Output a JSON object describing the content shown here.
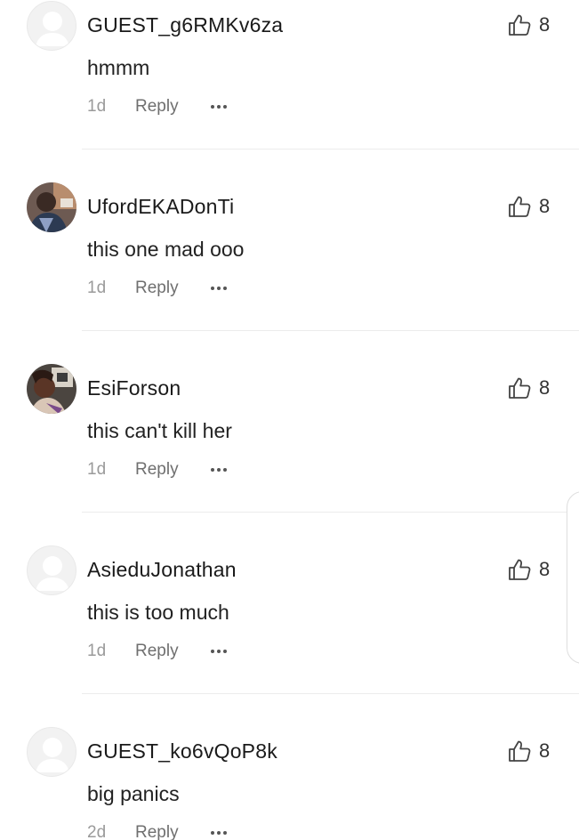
{
  "comments": [
    {
      "username": "GUEST_g6RMKv6za",
      "text": "hmmm",
      "time": "1d",
      "reply_label": "Reply",
      "likes": "8",
      "avatar": "default-avatar"
    },
    {
      "username": "UfordEKADonTi",
      "text": "this one mad ooo",
      "time": "1d",
      "reply_label": "Reply",
      "likes": "8",
      "avatar": "user-photo-avatar"
    },
    {
      "username": "EsiForson",
      "text": "this can't kill her",
      "time": "1d",
      "reply_label": "Reply",
      "likes": "8",
      "avatar": "user-photo-avatar"
    },
    {
      "username": "AsieduJonathan",
      "text": "this is too much",
      "time": "1d",
      "reply_label": "Reply",
      "likes": "8",
      "avatar": "default-avatar"
    },
    {
      "username": "GUEST_ko6vQoP8k",
      "text": "big panics",
      "time": "2d",
      "reply_label": "Reply",
      "likes": "8",
      "avatar": "default-avatar"
    }
  ],
  "icons": {
    "like": "thumbs-up-icon",
    "more": "more-options-icon"
  },
  "colors": {
    "username": "#1a1a1a",
    "timestamp": "#9a9a9a",
    "reply": "#6f6f6f",
    "divider": "#ececec",
    "avatar_placeholder": "#f2f2f2"
  }
}
